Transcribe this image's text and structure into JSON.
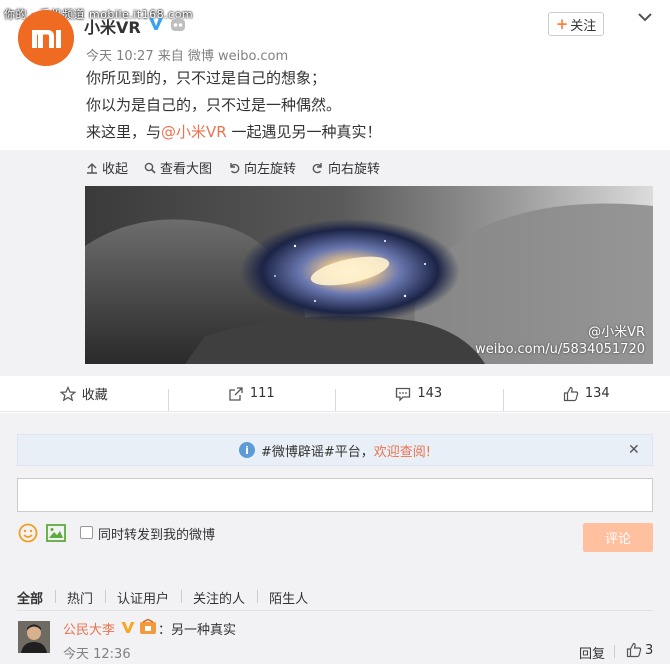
{
  "watermark": "你的 · 手机频道 mobile.it168.com",
  "post": {
    "author": "小米VR",
    "follow_label": "关注",
    "meta": "今天 10:27 来自 微博 weibo.com",
    "line1": "你所见到的，只不过是自己的想象；",
    "line2": "你以为是自己的，只不过是一种偶然。",
    "line3_prefix": "来这里，与",
    "line3_mention": "@小米VR",
    "line3_suffix": " 一起遇见另一种真实！"
  },
  "media_tools": [
    {
      "icon": "collapse-icon",
      "label": "收起"
    },
    {
      "icon": "search-icon",
      "label": "查看大图"
    },
    {
      "icon": "rotate-left-icon",
      "label": "向左旋转"
    },
    {
      "icon": "rotate-right-icon",
      "label": "向右旋转"
    }
  ],
  "photo_watermark": {
    "handle": "@小米VR",
    "url": "weibo.com/u/5834051720"
  },
  "actions": {
    "favorite": "收藏",
    "repost": "111",
    "comment": "143",
    "like": "134"
  },
  "notice": {
    "prefix": "#微博辟谣#平台，",
    "highlight": "欢迎查阅!"
  },
  "composer": {
    "repost_label": "同时转发到我的微博",
    "submit_label": "评论"
  },
  "filters": [
    "全部",
    "热门",
    "认证用户",
    "关注的人",
    "陌生人"
  ],
  "comment": {
    "user": "公民大李",
    "text": "：另一种真实",
    "time": "今天 12:36",
    "reply_label": "回复",
    "likes": "3"
  },
  "colors": {
    "brand_orange": "#ef6b21",
    "link_orange": "#eb7350",
    "panel_bg": "#f2f2f5",
    "notice_bg": "#e8eff7",
    "submit_disabled": "#ffc09f"
  }
}
